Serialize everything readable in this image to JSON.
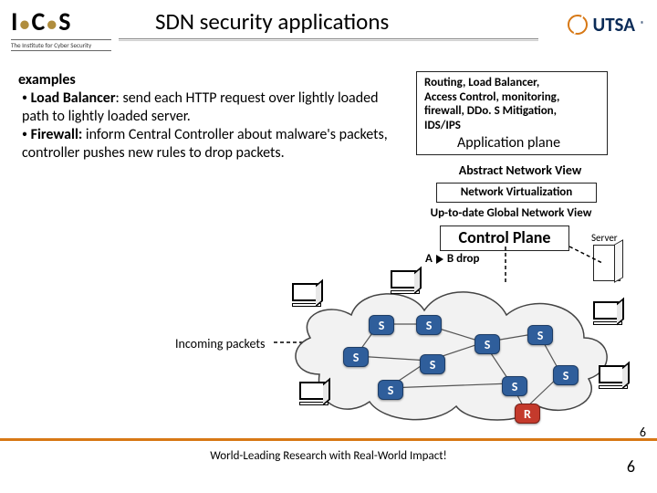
{
  "header": {
    "title": "SDN security applications",
    "ics_letters": "I·C·S",
    "ics_sub": "The Institute for Cyber Security",
    "utsa": "UTSA",
    "reg": "®"
  },
  "body": {
    "heading": "examples",
    "bullets": [
      {
        "lead": "Load Balancer",
        "rest": ": send each HTTP request over lightly loaded path to lightly loaded server."
      },
      {
        "lead": "Firewall:",
        "rest": "  inform Central Controller about malware's packets, controller pushes new rules to drop packets."
      }
    ]
  },
  "appbox": {
    "line1": "Routing, Load Balancer,",
    "line2": "Access Control, monitoring,",
    "line3": "firewall, DDo. S Mitigation,",
    "line4": "IDS/IPS",
    "plane": "Application plane"
  },
  "labels": {
    "abstract_view": "Abstract Network View",
    "net_virt": "Network Virtualization",
    "uptodate": "Up-to-date Global Network View",
    "control_plane": "Control Plane",
    "server": "Server",
    "abdrop_a": "A",
    "abdrop_b": "B drop",
    "incoming": "Incoming packets"
  },
  "nodes": {
    "s": "S",
    "r": "R"
  },
  "footer": {
    "text": "World-Leading Research with Real-World Impact!",
    "page_small": "6",
    "page_large": "6"
  }
}
